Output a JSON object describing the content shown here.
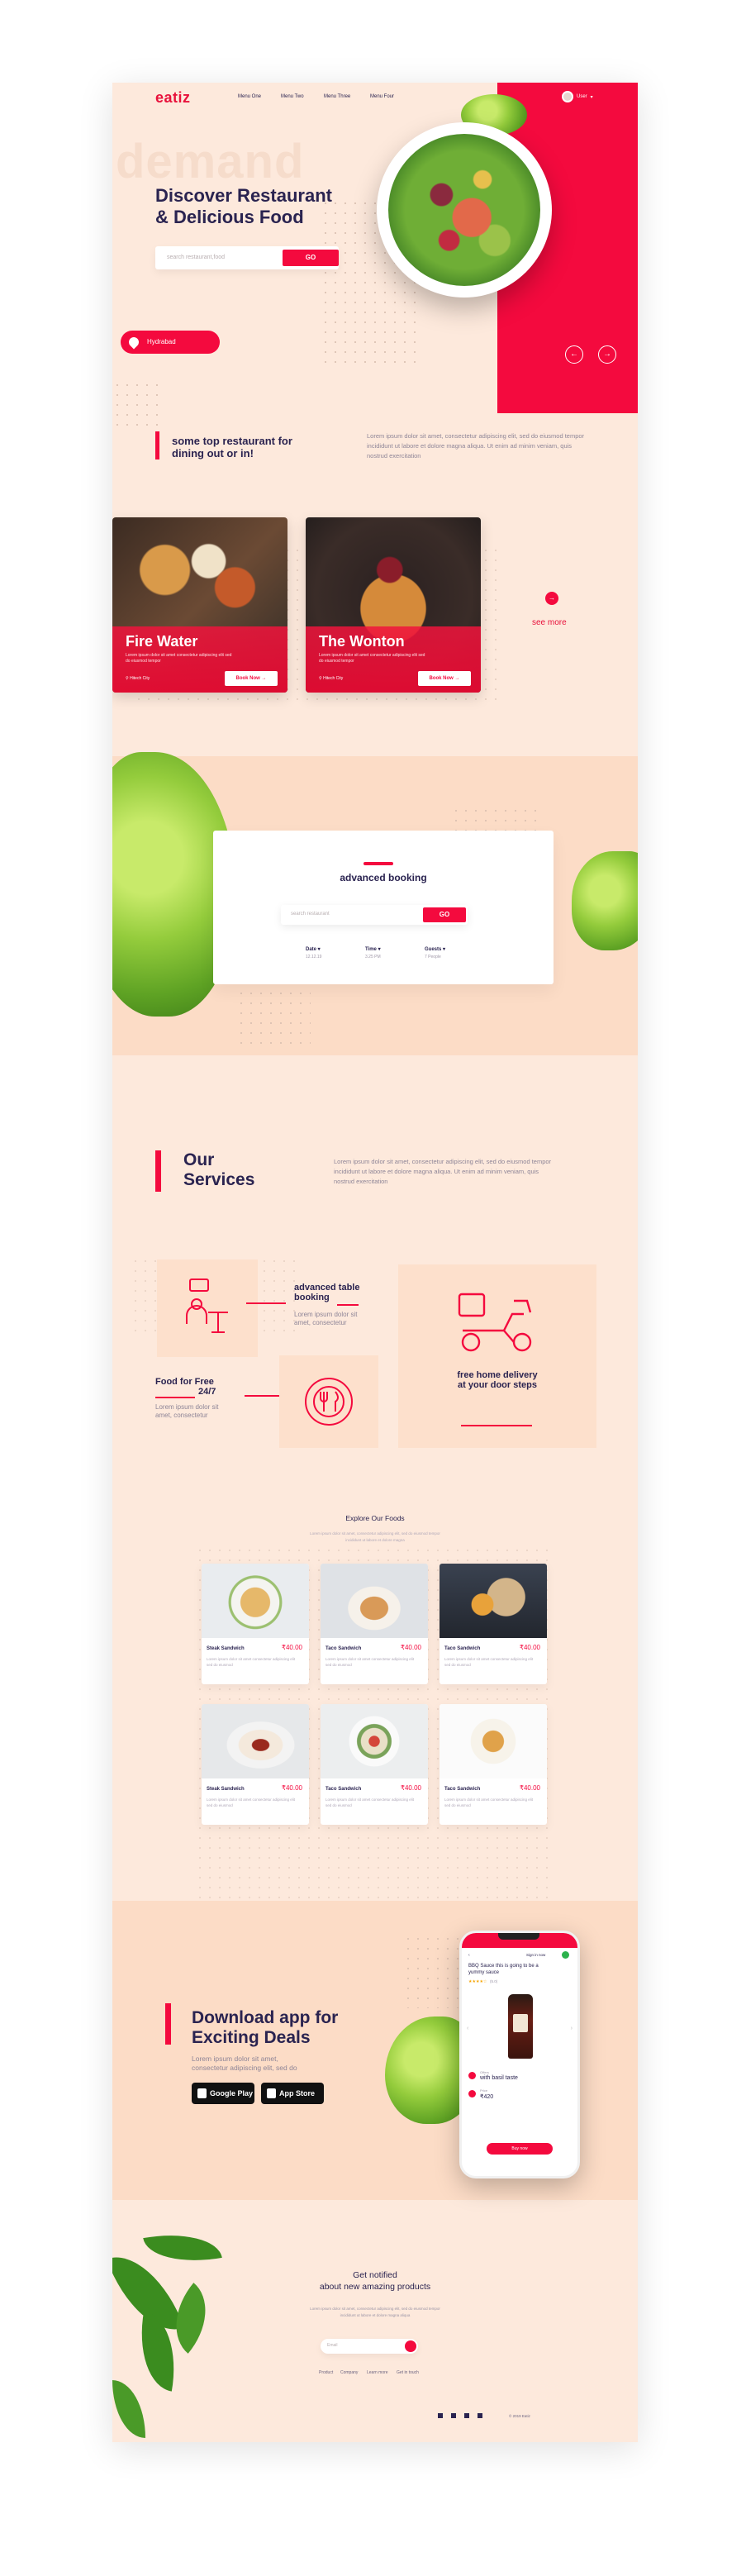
{
  "header": {
    "logo": "eatiz",
    "nav": [
      "Menu One",
      "Menu Two",
      "Menu Three",
      "Menu Four"
    ],
    "user_name": "User"
  },
  "hero": {
    "bg_word": "demand",
    "title_line1": "Discover Restaurant",
    "title_line2": "& Delicious Food",
    "search_placeholder": "search restaurant,food",
    "go_label": "GO",
    "location": "Hydrabad"
  },
  "top": {
    "title_line1": "some top restaurant for",
    "title_line2": "dining out or in!",
    "paragraph": "Lorem ipsum dolor sit amet, consectetur adipiscing elit, sed do eiusmod tempor incididunt ut labore et dolore magna aliqua. Ut enim ad minim veniam, quis nostrud exercitation"
  },
  "restaurants": [
    {
      "name": "Fire Water",
      "desc": "Lorem ipsum dolor sit amet consectetur adipiscing elit sed do eiusmod tempor",
      "location": "Hitech City",
      "book": "Book Now"
    },
    {
      "name": "The Wonton",
      "desc": "Lorem ipsum dolor sit amet consectetur adipiscing elit sed do eiusmod tempor",
      "location": "Hitech City",
      "book": "Book Now"
    }
  ],
  "see_more": "see more",
  "booking": {
    "title": "advanced booking",
    "search_placeholder": "search restaurant",
    "go_label": "GO",
    "fields": [
      {
        "label": "Date",
        "value": "12.12.19"
      },
      {
        "label": "Time",
        "value": "3.25 PM"
      },
      {
        "label": "Guests",
        "value": "7 People"
      }
    ]
  },
  "services": {
    "title_line1": "Our",
    "title_line2": "Services",
    "paragraph": "Lorem ipsum dolor sit amet, consectetur adipiscing elit, sed do eiusmod tempor incididunt ut labore et dolore magna aliqua. Ut enim ad minim veniam, quis nostrud exercitation",
    "table_title_line1": "advanced table",
    "table_title_line2": "booking",
    "table_desc_line1": "Lorem ipsum dolor sit",
    "table_desc_line2": "amet, consectetur",
    "food_title_line1": "Food for Free",
    "food_title_line2": "24/7",
    "food_desc_line1": "Lorem ipsum dolor sit",
    "food_desc_line2": "amet, consectetur",
    "delivery_line1": "free home delivery",
    "delivery_line2": "at your door steps"
  },
  "foods": {
    "title": "Explore Our Foods",
    "subtitle_line1": "Lorem ipsum dolor sit amet, consectetur adipiscing elit, sed do eiusmod tempor",
    "subtitle_line2": "incididunt ut labore et dolore magna",
    "items": [
      {
        "name": "Steak Sandwich",
        "price": "₹40.00",
        "desc": "Lorem ipsum dolor sit amet consectetur adipiscing elit sed do eiusmod"
      },
      {
        "name": "Taco Sandwich",
        "price": "₹40.00",
        "desc": "Lorem ipsum dolor sit amet consectetur adipiscing elit sed do eiusmod"
      },
      {
        "name": "Taco Sandwich",
        "price": "₹40.00",
        "desc": "Lorem ipsum dolor sit amet consectetur adipiscing elit sed do eiusmod"
      },
      {
        "name": "Steak Sandwich",
        "price": "₹40.00",
        "desc": "Lorem ipsum dolor sit amet consectetur adipiscing elit sed do eiusmod"
      },
      {
        "name": "Taco Sandwich",
        "price": "₹40.00",
        "desc": "Lorem ipsum dolor sit amet consectetur adipiscing elit sed do eiusmod"
      },
      {
        "name": "Taco Sandwich",
        "price": "₹40.00",
        "desc": "Lorem ipsum dolor sit amet consectetur adipiscing elit sed do eiusmod"
      }
    ]
  },
  "app": {
    "title_line1": "Download app for",
    "title_line2": "Exciting Deals",
    "desc_line1": "Lorem ipsum dolor sit amet,",
    "desc_line2": "consectetur adipiscing elit, sed do",
    "google_play": "Google Play",
    "app_store": "App Store",
    "phone": {
      "header": "Sign in now",
      "product": "BBQ Sauce this is going to be a yummy sauce",
      "rating": "★★★★☆",
      "reviews": "(5.0)",
      "offer_label": "Offers",
      "offer_text": "with basil taste",
      "price_label": "Price",
      "price": "₹420",
      "buy": "Buy now"
    }
  },
  "newsletter": {
    "title_line1": "Get notified",
    "title_line2": "about new amazing products",
    "desc_line1": "Lorem ipsum dolor sit amet, consectetur adipiscing elit, sed do eiusmod tempor",
    "desc_line2": "incididunt ut labore et dolore magna aliqua",
    "email_placeholder": "Email",
    "links": [
      "Product",
      "Company",
      "Learn more",
      "Get in touch"
    ],
    "copyright": "© 2019 Eatiz"
  },
  "colors": {
    "accent": "#f40a3e",
    "navy": "#2a2350",
    "cream": "#fde9dc"
  }
}
